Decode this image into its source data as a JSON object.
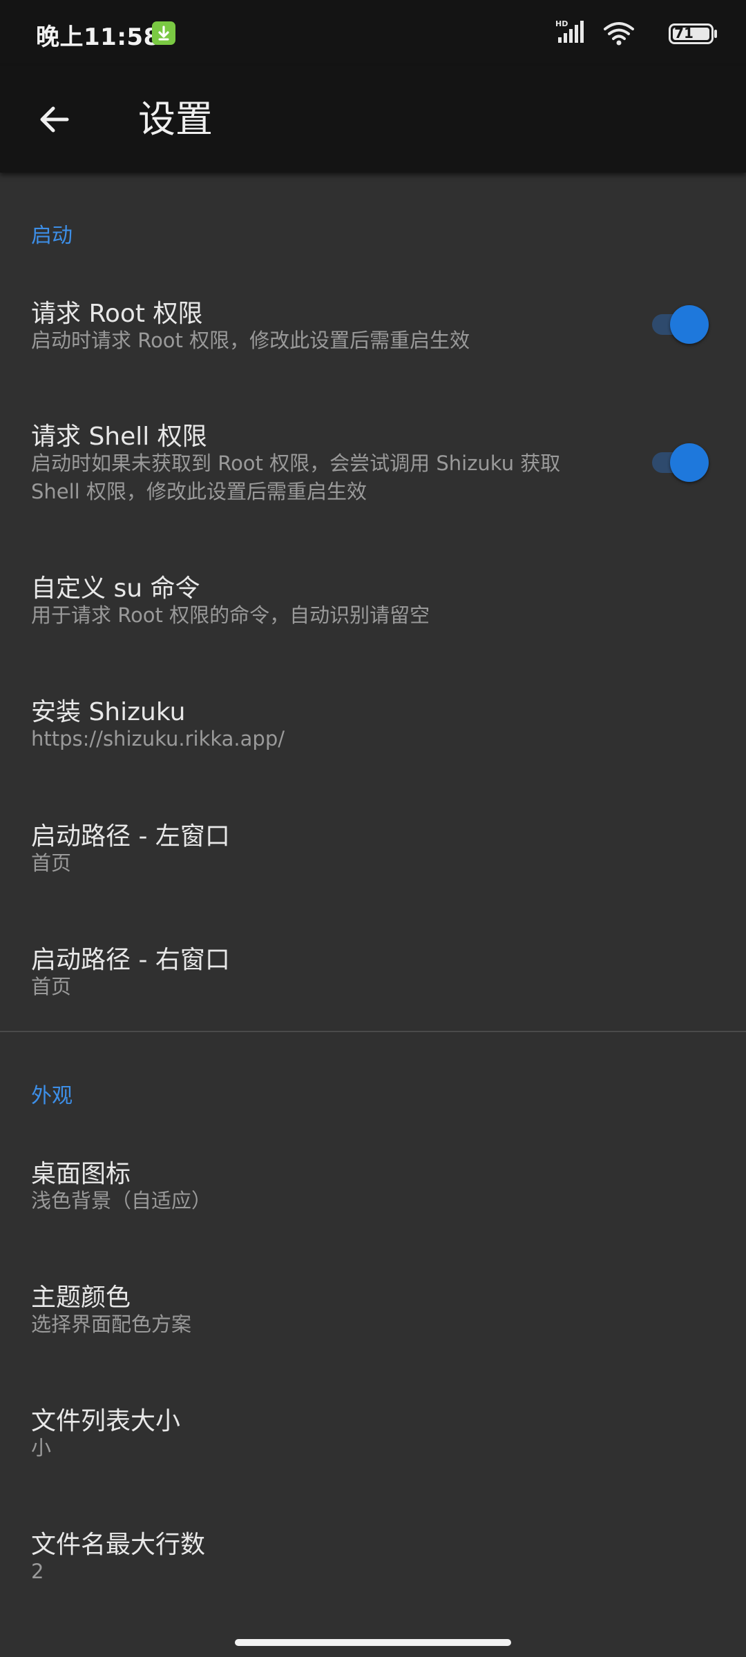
{
  "status_bar": {
    "time": "晚上11:58",
    "network_label": "HD",
    "battery": "71",
    "icons": [
      "download-notification-icon",
      "signal-icon",
      "wifi-icon",
      "battery-icon"
    ]
  },
  "app_bar": {
    "title": "设置",
    "back_icon": "arrow-back-icon"
  },
  "sections": [
    {
      "header": "启动",
      "items": [
        {
          "title": "请求 Root 权限",
          "summary": "启动时请求 Root 权限，修改此设置后需重启生效",
          "toggle": true
        },
        {
          "title": "请求 Shell 权限",
          "summary_lines": [
            "启动时如果未获取到 Root 权限，会尝试调用 Shizuku 获取",
            "Shell 权限，修改此设置后需重启生效"
          ],
          "toggle": true
        },
        {
          "title": "自定义 su 命令",
          "summary": "用于请求 Root 权限的命令，自动识别请留空"
        },
        {
          "title": "安装 Shizuku",
          "summary": "https://shizuku.rikka.app/"
        },
        {
          "title": "启动路径 - 左窗口",
          "summary": "首页"
        },
        {
          "title": "启动路径 - 右窗口",
          "summary": "首页"
        }
      ]
    },
    {
      "header": "外观",
      "items": [
        {
          "title": "桌面图标",
          "summary": "浅色背景（自适应）"
        },
        {
          "title": "主题颜色",
          "summary": "选择界面配色方案"
        },
        {
          "title": "文件列表大小",
          "summary": "小"
        },
        {
          "title": "文件名最大行数",
          "summary": "2"
        }
      ]
    }
  ],
  "colors": {
    "accent": "#3d8fe8",
    "background": "#303030",
    "bar": "#141414",
    "toggle_on": "#1e78dc"
  }
}
